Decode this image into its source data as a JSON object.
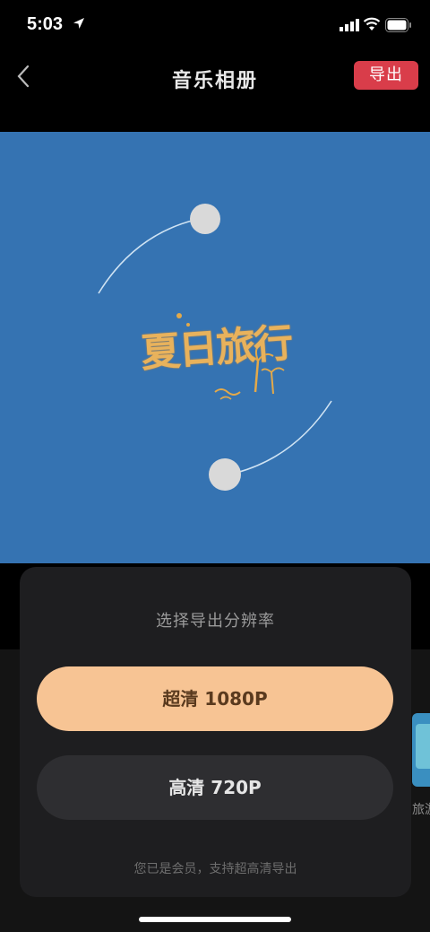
{
  "status_bar": {
    "time": "5:03"
  },
  "nav": {
    "title": "音乐相册",
    "export_label": "导出"
  },
  "preview": {
    "background": "#3573b2",
    "logo_text": "夏日旅行"
  },
  "export_sheet": {
    "title": "选择导出分辨率",
    "options": [
      {
        "label": "超清 1080P",
        "selected": true
      },
      {
        "label": "高清 720P",
        "selected": false
      }
    ],
    "note": "您已是会员，支持超高清导出"
  },
  "background_item": {
    "label": "旅游"
  },
  "colors": {
    "accent_red": "#d93d4a",
    "peach": "#f7c494",
    "sheet_bg": "#1e1e20"
  }
}
